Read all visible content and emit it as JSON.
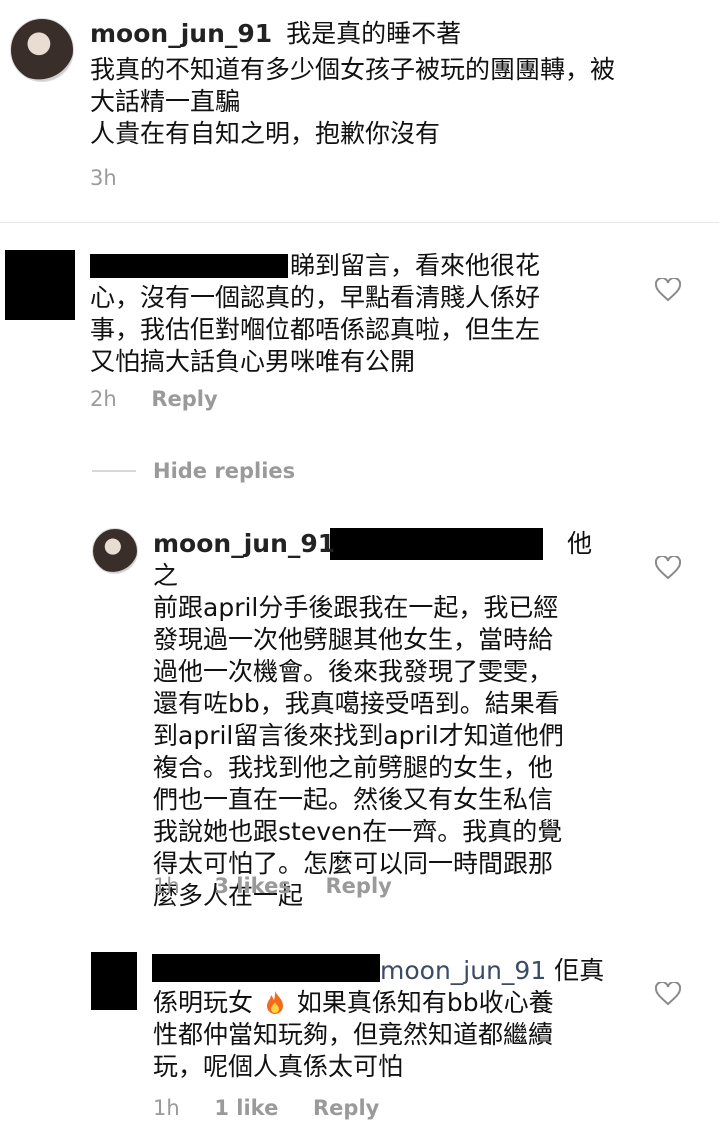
{
  "comment1": {
    "username": "moon_jun_91",
    "lines": [
      "我是真的睡不著",
      "我真的不知道有多少個女孩子被玩的團團轉，被",
      "大話精一直騙",
      "人貴在有自知之明，抱歉你沒有"
    ],
    "time": "3h"
  },
  "comment2": {
    "lines": [
      "睇到留言，看來他很花",
      "心，沒有一個認真的，早點看清賤人係好",
      "事，我估佢對嗰位都唔係認真啦，但生左",
      "又怕搞大話負心男咪唯有公開"
    ],
    "time": "2h",
    "reply_label": "Reply"
  },
  "hide_replies": "Hide replies",
  "reply1": {
    "username": "moon_jun_91",
    "lines": [
      "他之",
      "前跟april分手後跟我在一起，我已經",
      "發現過一次他劈腿其他女生，當時給",
      "過他一次機會。後來我發現了雯雯，",
      "還有咗bb，我真噶接受唔到。結果看",
      "到april留言後來找到april才知道他們",
      "複合。我找到他之前劈腿的女生，他",
      "們也一直在一起。然後又有女生私信",
      "我說她也跟steven在一齊。我真的覺",
      "得太可怕了。怎麼可以同一時間跟那",
      "麼多人在一起"
    ],
    "time": "1h",
    "likes": "3 likes",
    "reply_label": "Reply"
  },
  "reply2": {
    "mention": "moon_jun_91",
    "lines": [
      "佢真",
      "係明玩女",
      "如果真係知有bb收心養",
      "性都仲當知玩夠，但竟然知道都繼續",
      "玩，呢個人真係太可怕"
    ],
    "time": "1h",
    "likes": "1 like",
    "reply_label": "Reply"
  },
  "icons": [
    "heart-outline-icon",
    "fire-emoji-icon"
  ]
}
